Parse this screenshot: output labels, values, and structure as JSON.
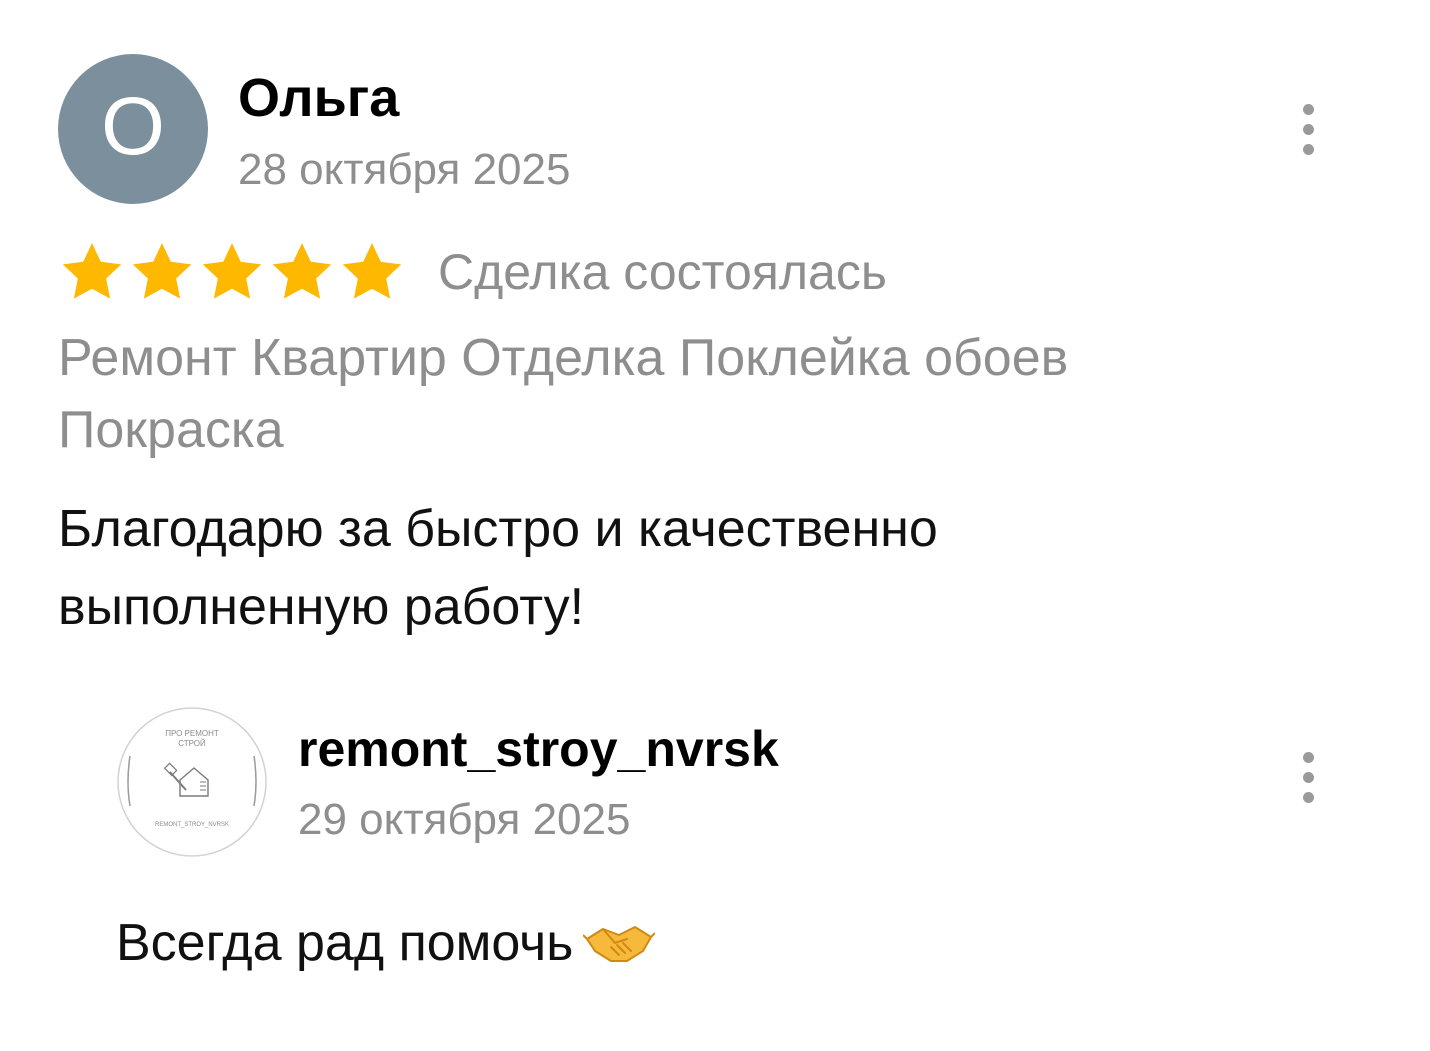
{
  "review": {
    "avatar_letter": "О",
    "author": "Ольга",
    "date": "28 октября 2025",
    "rating": 5,
    "rating_max": 5,
    "deal_status": "Сделка состоялась",
    "tags": "Ремонт Квартир Отделка Поклейка обоев Покраска",
    "text": "Благодарю за быстро и качественно выполненную работу!",
    "menu_icon": "more-vertical-icon"
  },
  "reply": {
    "author": "remont_stroy_nvrsk",
    "date": "29 октября 2025",
    "text": "Всегда рад помочь",
    "emoji_icon": "handshake-icon",
    "menu_icon": "more-vertical-icon",
    "logo": {
      "top_text": "ПРО РЕМОНТ СТРОЙ",
      "bottom_text": "REMONT_STROY_NVRSK"
    }
  },
  "colors": {
    "avatar_bg": "#7b909c",
    "star": "#ffb800",
    "muted_text": "#8e8e8e"
  }
}
